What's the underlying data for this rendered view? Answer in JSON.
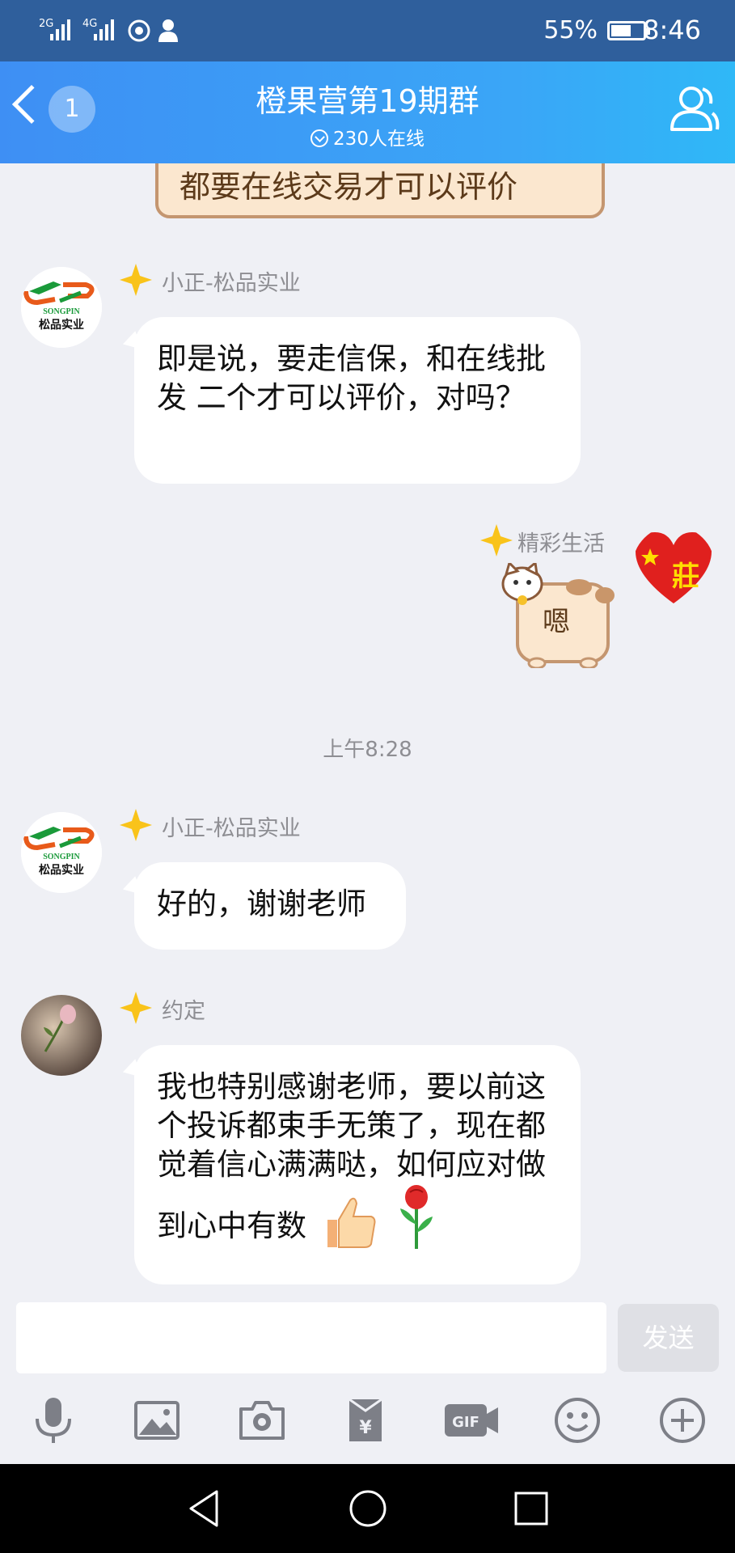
{
  "status_bar": {
    "sim1": "2G",
    "sim2": "4G",
    "battery": "55%",
    "time": "8:46"
  },
  "header": {
    "back_badge": "1",
    "title": "橙果营第19期群",
    "online": "230人在线"
  },
  "chat": {
    "top_sticker_text": "都要在线交易才可以评价",
    "messages": [
      {
        "sender": "小正-松品实业",
        "text": "即是说，要走信保，和在线批发 二个才可以评价，对吗？"
      },
      {
        "sender": "精彩生活",
        "sticker_text": "嗯"
      },
      {
        "sender": "小正-松品实业",
        "text": "好的，谢谢老师"
      },
      {
        "sender": "约定",
        "text": "我也特别感谢老师，要以前这个投诉都束手无策了，现在都觉着信心满满哒，如何应对做到心中有数"
      }
    ],
    "time_separator": "上午8:28",
    "logo_brand": "SONGPIN",
    "logo_cn": "松品实业",
    "avatar_right_text": "莊"
  },
  "input": {
    "send_label": "发送",
    "placeholder": ""
  },
  "toolbar": {
    "icons": [
      "microphone-icon",
      "image-icon",
      "camera-icon",
      "red-packet-icon",
      "gif-icon",
      "emoji-icon",
      "plus-icon"
    ],
    "gif_label": "GIF",
    "yuan_label": "¥"
  },
  "colors": {
    "header_start": "#3e8ff4",
    "header_end": "#2fb8f7",
    "chat_bg": "#eff0f5",
    "bubble": "#ffffff"
  }
}
